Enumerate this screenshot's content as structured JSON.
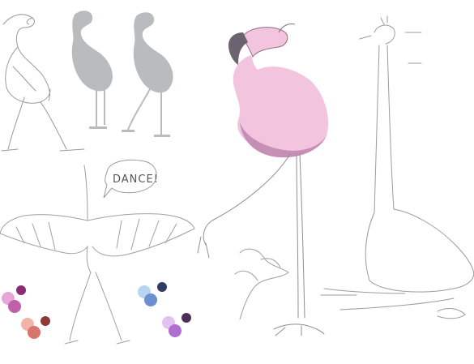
{
  "artwork": {
    "speech_bubble_text": "DANCE!",
    "colors": {
      "pink": "#f2c4de",
      "pink_shadow": "#c58fb6",
      "beak_dark": "#6b6370",
      "sketch_line": "#9a9a9a",
      "silhouette_gray": "#b9bcbe"
    },
    "swatch_groups": [
      {
        "colors": [
          "#e7a6d8",
          "#c25fa9",
          "#8a2e73"
        ]
      },
      {
        "colors": [
          "#f1b3a8",
          "#d8746c",
          "#8d3a38"
        ]
      },
      {
        "colors": [
          "#b7d4f1",
          "#6c8fcf",
          "#2f3d66"
        ]
      },
      {
        "colors": [
          "#e3c2ef",
          "#b06fd0",
          "#4e2f57"
        ]
      }
    ]
  }
}
